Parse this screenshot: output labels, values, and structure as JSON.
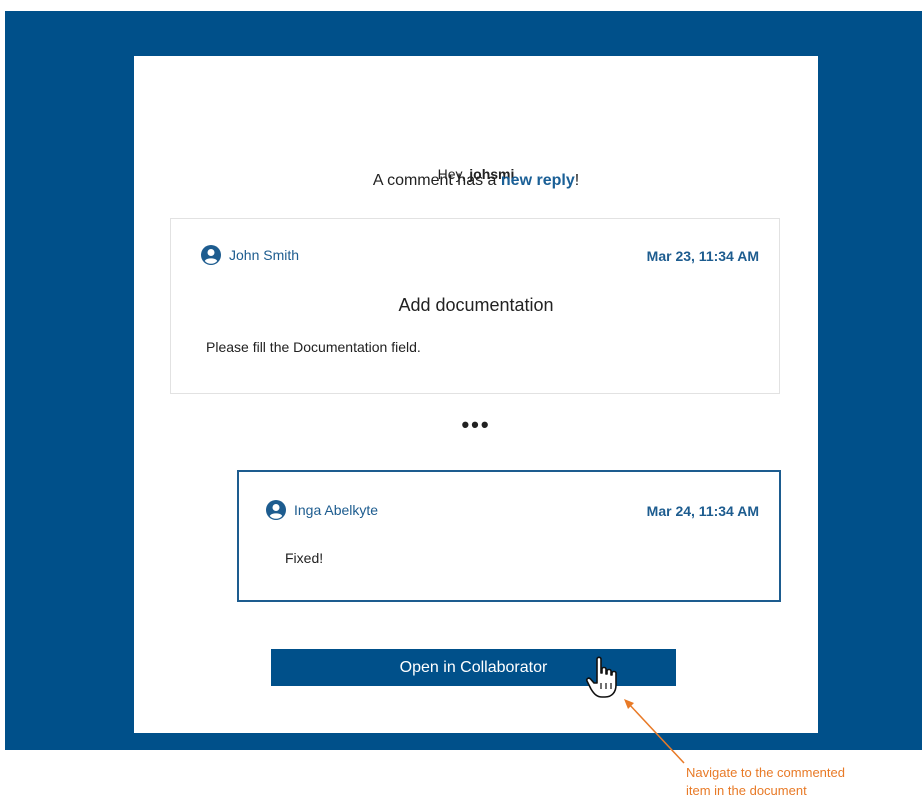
{
  "email": {
    "greeting_prefix": "Hey,",
    "username": "johsmi",
    "headline_prefix": "A comment has a",
    "headline_accent": "new reply",
    "headline_suffix": "!",
    "ellipsis": "•••",
    "open_button_label": "Open in Collaborator"
  },
  "comment": {
    "author": "John Smith",
    "date": "Mar 23, 11:34 AM",
    "title": "Add documentation",
    "text": "Please fill the Documentation field."
  },
  "reply": {
    "author": "Inga Abelkyte",
    "date": "Mar 24, 11:34 AM",
    "text": "Fixed!"
  },
  "callout": {
    "line1": "Navigate to the commented",
    "line2": "item in the document"
  },
  "colors": {
    "brand_blue": "#00508a",
    "link_blue": "#1d5c8f",
    "callout_orange": "#e87a27"
  },
  "icons": {
    "author": "user-circle-icon",
    "cursor": "hand-pointer-icon"
  }
}
